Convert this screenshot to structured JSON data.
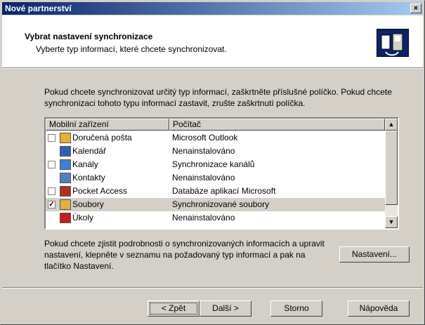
{
  "window": {
    "title": "Nové partnerství",
    "close_label": "×"
  },
  "header": {
    "title": "Vybrat nastavení synchronizace",
    "subtitle": "Vyberte typ informací, které chcete synchronizovat.",
    "icon": "sync-device-icon"
  },
  "intro_text": "Pokud chcete synchronizovat určitý typ informací, zaškrtněte příslušné políčko. Pokud chcete synchronizaci tohoto typu informací zastavit, zrušte zaškrtnutí políčka.",
  "list": {
    "columns": [
      "Mobilní zařízení",
      "Počítač"
    ],
    "rows": [
      {
        "name": "Doručená pošta",
        "value": "Microsoft Outlook",
        "checkbox": true,
        "checked": false,
        "icon": "inbox-icon",
        "color": "#e8b030"
      },
      {
        "name": "Kalendář",
        "value": "Nenainstalováno",
        "checkbox": false,
        "checked": false,
        "icon": "calendar-icon",
        "color": "#3060b0"
      },
      {
        "name": "Kanály",
        "value": "Synchronizace kanálů",
        "checkbox": true,
        "checked": false,
        "icon": "channels-icon",
        "color": "#4080d0"
      },
      {
        "name": "Kontakty",
        "value": "Nenainstalováno",
        "checkbox": false,
        "checked": false,
        "icon": "contacts-icon",
        "color": "#5080c0"
      },
      {
        "name": "Pocket Access",
        "value": "Databáze aplikací Microsoft",
        "checkbox": true,
        "checked": false,
        "icon": "pocket-access-icon",
        "color": "#b03020"
      },
      {
        "name": "Soubory",
        "value": "Synchronizované soubory",
        "checkbox": true,
        "checked": true,
        "icon": "files-icon",
        "color": "#e0b040",
        "selected": true
      },
      {
        "name": "Úkoly",
        "value": "Nenainstalováno",
        "checkbox": false,
        "checked": false,
        "icon": "tasks-icon",
        "color": "#c02020"
      }
    ]
  },
  "info_text": "Pokud chcete zjistit podrobnosti o synchronizovaných informacích a upravit nastavení, klepněte v seznamu na požadovaný typ informací a pak na tlačítko Nastavení.",
  "buttons": {
    "settings": "Nastavení...",
    "back": "< Zpět",
    "next": "Další >",
    "cancel": "Storno",
    "help": "Nápověda"
  }
}
